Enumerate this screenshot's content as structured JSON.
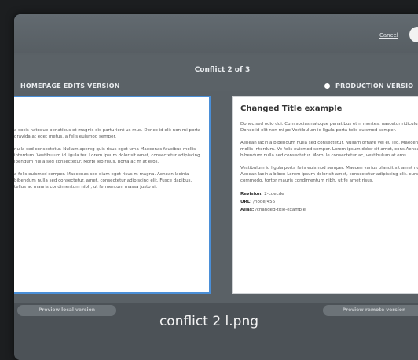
{
  "header": {
    "cancel_label": "Cancel",
    "conflict_counter": "Conflict 2 of 3"
  },
  "local": {
    "version_label": "HOMEPAGE EDITS VERSION",
    "paragraphs": [
      "a socis natoque penatibus et magnis dis parturient us mus. Donec id elit non mi porta gravida at eget metus. a felis euismod semper.",
      "nulla sed consectetur. Nullam apereg quis risus eget urna Maecenas faucibus mollis interdum. Vestibulum id ligula ter. Lorem ipsum dolor sit amet, consectetur adipiscing ibendum nulla sed consectetur. Morbi leo risus, porta ac m at eros.",
      "a felis euismod semper. Maecenas sed diam eget risus m magna. Aenean lacinia bibendum nulla sed consectetur. amet, consectetur adipiscing elit. Fusce dapibus, tellus ac mauris condimentum nibh, ut fermentum massa justo sit"
    ],
    "preview_button": "Preview local version"
  },
  "remote": {
    "version_label": "PRODUCTION VERSIO",
    "title": "Changed Title example",
    "paragraphs": [
      "Donec sed odio dui. Cum socias natoque penatibus et n montes, nascetur ridiculus mus. Donec id elit non mi po Vestibulum id ligula porta felis euismod semper.",
      "Aenean lacinia bibendum nulla sed consectetur. Nullam ornare vel eu leo. Maecenas faucibus mollis interdum. Ve felis euismod semper. Lorem ipsum dolor sit amet, cons Aenean lacinia bibendum nulla sed consectetur. Morbi le consectetur ac, vestibulum at eros.",
      "Vestibulum id ligula porta felis euismod semper. Maecen varius blandit sit amet non magna. Aenean lacinia biben Lorem ipsum dolor sit amet, consectetur adipiscing elit. cursus commodo, tortor mauris condimentum nibh, ut fe amet risus."
    ],
    "revision_label": "Revision:",
    "revision_value": "2-cdecde",
    "url_label": "URL:",
    "url_value": "/node/456",
    "alias_label": "Alias:",
    "alias_value": "/changed-title-example",
    "preview_button": "Preview remote version"
  },
  "caption": "conflict 2 l.png"
}
